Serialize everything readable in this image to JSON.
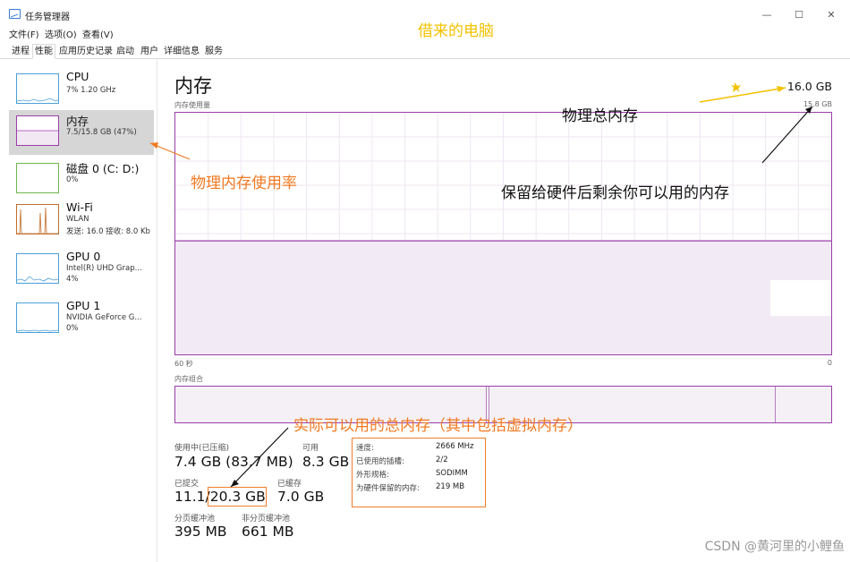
{
  "window": {
    "title": "任务管理器",
    "minimize": "—",
    "maximize": "☐",
    "close": "✕"
  },
  "menu": [
    "文件(F)",
    "选项(O)",
    "查看(V)"
  ],
  "tabs": [
    "进程",
    "性能",
    "应用历史记录",
    "启动",
    "用户",
    "详细信息",
    "服务"
  ],
  "active_tab": "性能",
  "sidebar": {
    "items": [
      {
        "name": "CPU",
        "sub1": "7%  1.20 GHz",
        "sub2": ""
      },
      {
        "name": "内存",
        "sub1": "7.5/15.8 GB (47%)",
        "sub2": ""
      },
      {
        "name": "磁盘 0 (C: D:)",
        "sub1": "0%",
        "sub2": ""
      },
      {
        "name": "Wi-Fi",
        "sub1": "WLAN",
        "sub2": "发送: 16.0  接收: 8.0 Kb"
      },
      {
        "name": "GPU 0",
        "sub1": "Intel(R) UHD Grap...",
        "sub2": "4%"
      },
      {
        "name": "GPU 1",
        "sub1": "NVIDIA GeForce G...",
        "sub2": "0%"
      }
    ]
  },
  "main": {
    "title": "内存",
    "total": "16.0 GB",
    "usage_label": "内存使用量",
    "usage_max": "15.8 GB",
    "usage_level": 0.47,
    "time_left": "60 秒",
    "time_right": "0",
    "composition_label": "内存组合"
  },
  "stats": {
    "in_use_label": "使用中(已压缩)",
    "in_use_value": "7.4 GB (83.7 MB)",
    "available_label": "可用",
    "available_value": "8.3 GB",
    "committed_label": "已提交",
    "committed_value": "11.1/20.3 GB",
    "cached_label": "已缓存",
    "cached_value": "7.0 GB",
    "paged_label": "分页缓冲池",
    "paged_value": "395 MB",
    "nonpaged_label": "非分页缓冲池",
    "nonpaged_value": "661 MB"
  },
  "info": [
    {
      "k": "速度:",
      "v": "2666 MHz"
    },
    {
      "k": "已使用的插槽:",
      "v": "2/2"
    },
    {
      "k": "外形规格:",
      "v": "SODIMM"
    },
    {
      "k": "为硬件保留的内存:",
      "v": "219 MB"
    }
  ],
  "annotations": {
    "borrowed": "借来的电脑",
    "physical_usage": "物理内存使用率",
    "physical_total": "物理总内存",
    "remaining": "保留给硬件后剩余你可以用的内存",
    "total_usable": "实际可以用的总内存（其中包括虚拟内存）"
  },
  "watermark": "CSDN @黄河里的小鲤鱼",
  "colors": {
    "memory_accent": "#9b3ea9",
    "annotation_orange": "#f07a22",
    "annotation_yellow": "#f2c200"
  }
}
